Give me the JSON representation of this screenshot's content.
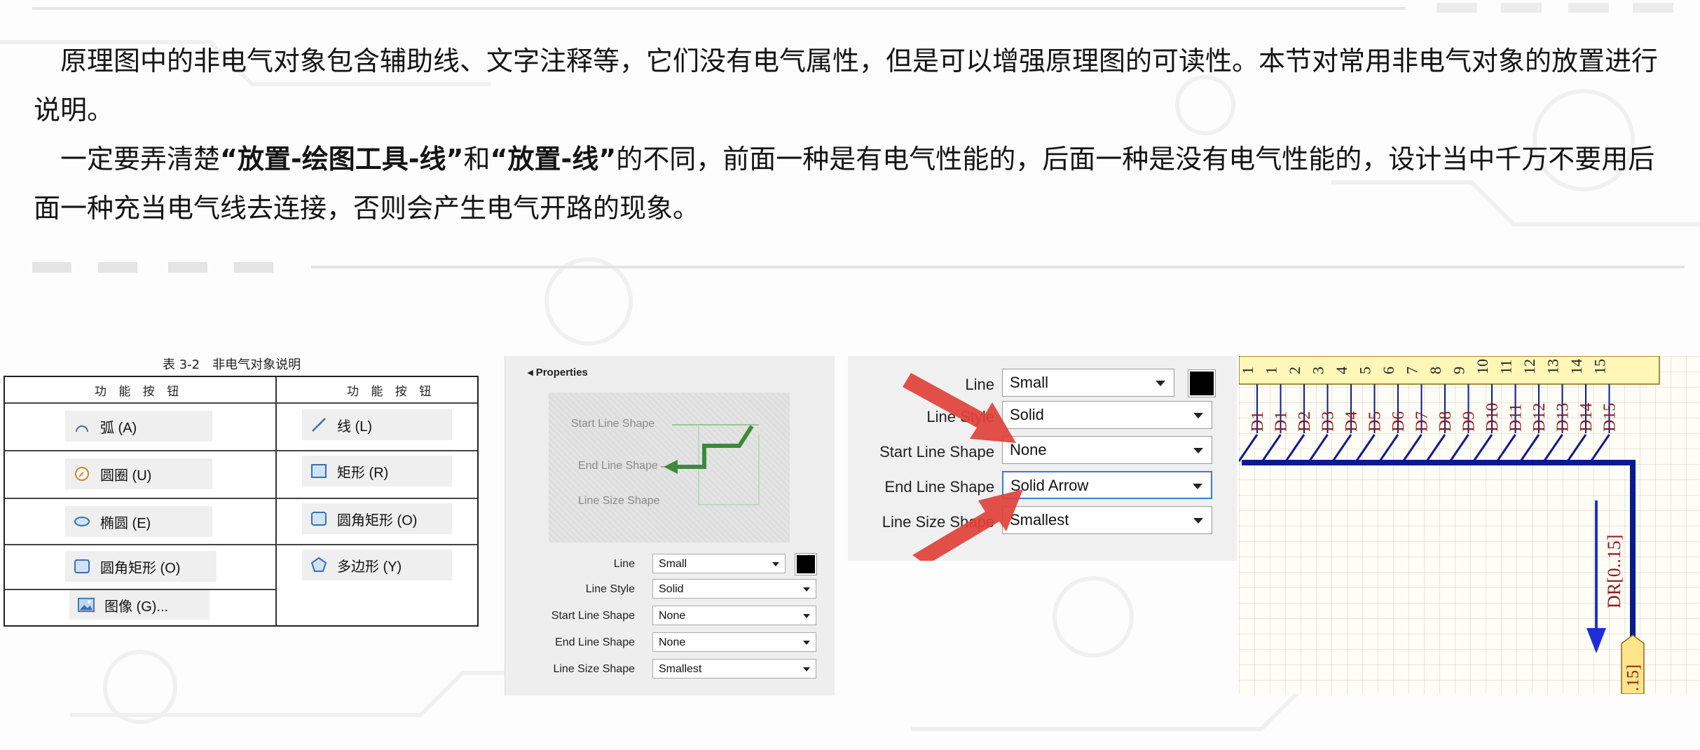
{
  "paragraphs": {
    "p1": "原理图中的非电气对象包含辅助线、文字注释等，它们没有电气属性，但是可以增强原理图的可读性。本节对常用非电气对象的放置进行说明。",
    "p2_a": "一定要弄清楚",
    "p2_b": "“放置-绘图工具-线”",
    "p2_c": "和",
    "p2_d": "“放置-线”",
    "p2_e": "的不同，前面一种是有电气性能的，后面一种是没有电气性能的，设计当中千万不要用后面一种充当电气线去连接，否则会产生电气开路的现象。"
  },
  "table": {
    "caption": "表 3-2　非电气对象说明",
    "col_header_left": "功 能 按 钮",
    "col_header_right": "功 能 按 钮",
    "left_buttons": [
      {
        "label": "弧 (A)",
        "icon": "arc-icon"
      },
      {
        "label": "圆圈 (U)",
        "icon": "circle-icon"
      },
      {
        "label": "椭圆 (E)",
        "icon": "ellipse-icon"
      },
      {
        "label": "圆角矩形 (O)",
        "icon": "rounded-rect-icon"
      },
      {
        "label": "图像 (G)...",
        "icon": "image-icon"
      }
    ],
    "right_buttons": [
      {
        "label": "线 (L)",
        "icon": "line-icon"
      },
      {
        "label": "矩形 (R)",
        "icon": "rect-icon"
      },
      {
        "label": "圆角矩形 (O)",
        "icon": "rounded-rect-icon"
      },
      {
        "label": "多边形 (Y)",
        "icon": "polygon-icon"
      }
    ]
  },
  "properties": {
    "title": "Properties",
    "preview": {
      "start_line_shape": "Start Line Shape",
      "end_line_shape": "End Line Shape",
      "line_size_shape": "Line Size Shape"
    },
    "rows": [
      {
        "label": "Line",
        "value": "Small"
      },
      {
        "label": "Line Style",
        "value": "Solid"
      },
      {
        "label": "Start Line Shape",
        "value": "None"
      },
      {
        "label": "End Line Shape",
        "value": "None"
      },
      {
        "label": "Line Size Shape",
        "value": "Smallest"
      }
    ],
    "line_color": "#000000"
  },
  "zoom": {
    "rows": [
      {
        "label": "Line",
        "value": "Small"
      },
      {
        "label": "Line Style",
        "value": "Solid"
      },
      {
        "label": "Start Line Shape",
        "value": "None"
      },
      {
        "label": "End Line Shape",
        "value": "Solid Arrow"
      },
      {
        "label": "Line Size Shape",
        "value": "Smallest"
      }
    ],
    "arrow_color": "#e0413a"
  },
  "schematic": {
    "pins": [
      "D1",
      "D1",
      "D2",
      "D3",
      "D4",
      "D5",
      "D6",
      "D7",
      "D8",
      "D9",
      "D10",
      "D11",
      "D12",
      "D13",
      "D14",
      "D15"
    ],
    "top_numbers": [
      "1",
      "1",
      "2",
      "3",
      "4",
      "5",
      "6",
      "7",
      "8",
      "9",
      "10",
      "11",
      "12",
      "13",
      "14",
      "15"
    ],
    "bus_label": "DR[0..15]",
    "port_label": ".15]",
    "pin_color": "#8b1a1a",
    "bus_color": "#0b1a8c",
    "arrow_color": "#1f2fd6"
  }
}
